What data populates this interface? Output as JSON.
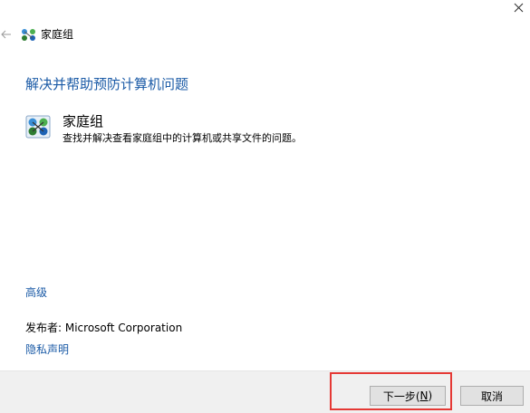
{
  "window": {
    "title": "家庭组",
    "icon": "homegroup-icon",
    "close_glyph": "✕",
    "back_glyph": "←"
  },
  "main": {
    "heading": "解决并帮助预防计算机问题",
    "item": {
      "title": "家庭组",
      "description": "查找并解决查看家庭组中的计算机或共享文件的问题。",
      "icon": "homegroup-icon"
    },
    "advanced_link": "高级",
    "publisher": "发布者:  Microsoft Corporation",
    "privacy_link": "隐私声明"
  },
  "footer": {
    "next_label_prefix": "下一步(",
    "next_label_accel": "N",
    "next_label_suffix": ")",
    "cancel_label": "取消"
  },
  "colors": {
    "link": "#1a5aa6",
    "highlight": "#e53935",
    "footer_bg": "#f0f0f0"
  }
}
